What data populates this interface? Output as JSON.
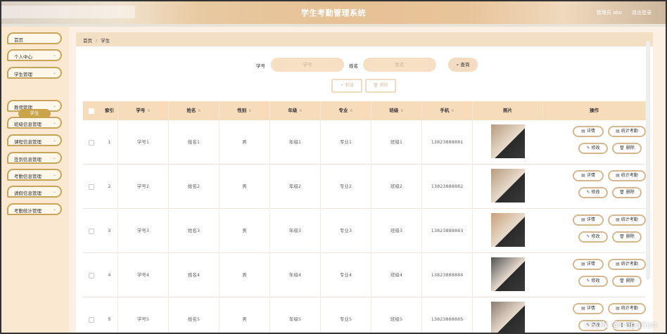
{
  "header": {
    "title": "学生考勤管理系统",
    "user": "管理员 abo",
    "logout": "退出登录"
  },
  "sidebar": {
    "items": [
      {
        "label": "首页",
        "has_chevron": false
      },
      {
        "label": "个人中心",
        "has_chevron": true
      },
      {
        "label": "学生管理",
        "has_chevron": true
      },
      {
        "label": "教师管理",
        "has_chevron": true
      },
      {
        "label": "班级信息管理",
        "has_chevron": true
      },
      {
        "label": "课程信息管理",
        "has_chevron": true
      },
      {
        "label": "签到信息管理",
        "has_chevron": true
      },
      {
        "label": "考勤信息管理",
        "has_chevron": true
      },
      {
        "label": "请假信息管理",
        "has_chevron": true
      },
      {
        "label": "考勤统计管理",
        "has_chevron": true
      }
    ],
    "active_sub": "学生",
    "chevron_icon": "⌄"
  },
  "breadcrumb": {
    "home": "首页",
    "sep": "/",
    "current": "学生"
  },
  "search": {
    "field1_label": "学号",
    "field1_placeholder": "学号",
    "field2_label": "姓名",
    "field2_placeholder": "姓名",
    "button": "查询",
    "button_icon": "⌕"
  },
  "actions": {
    "add": "+ 新增",
    "delete": "删除"
  },
  "table": {
    "headers": [
      "索引",
      "学号",
      "姓名",
      "性别",
      "年级",
      "专业",
      "班级",
      "手机",
      "照片",
      "操作"
    ],
    "rows": [
      {
        "index": "1",
        "id": "学号1",
        "name": "姓名1",
        "gender": "男",
        "grade": "年级1",
        "major": "专业1",
        "class": "班级1",
        "phone": "13823888881"
      },
      {
        "index": "2",
        "id": "学号2",
        "name": "姓名2",
        "gender": "男",
        "grade": "年级2",
        "major": "专业2",
        "class": "班级2",
        "phone": "13823888882"
      },
      {
        "index": "3",
        "id": "学号3",
        "name": "姓名3",
        "gender": "男",
        "grade": "年级3",
        "major": "专业3",
        "class": "班级3",
        "phone": "13823888883"
      },
      {
        "index": "4",
        "id": "学号4",
        "name": "姓名4",
        "gender": "男",
        "grade": "年级4",
        "major": "专业4",
        "class": "班级4",
        "phone": "13823888884"
      },
      {
        "index": "5",
        "id": "学号5",
        "name": "姓名5",
        "gender": "男",
        "grade": "年级5",
        "major": "专业5",
        "class": "班级5",
        "phone": "13823888885"
      }
    ],
    "ops": {
      "detail": "详情",
      "stats": "统计考勤",
      "edit": "修改",
      "delete": "删除"
    }
  },
  "watermark": "CSDN @Irepation",
  "colors": {
    "accent": "#c9a44a",
    "header_bg": "#e6c196",
    "table_head": "#f7dcbc"
  }
}
